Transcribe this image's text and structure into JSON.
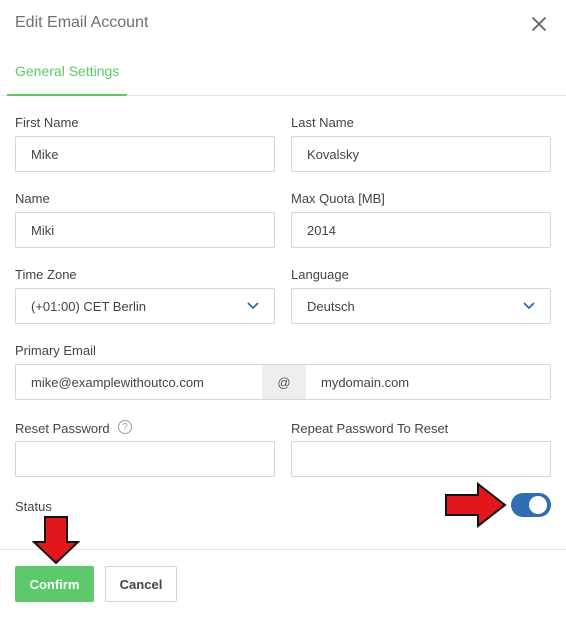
{
  "modal": {
    "title": "Edit Email Account",
    "close_icon": "close-icon"
  },
  "tabs": [
    {
      "label": "General Settings",
      "active": true
    }
  ],
  "form": {
    "first_name": {
      "label": "First Name",
      "value": "Mike"
    },
    "last_name": {
      "label": "Last Name",
      "value": "Kovalsky"
    },
    "name": {
      "label": "Name",
      "value": "Miki"
    },
    "max_quota": {
      "label": "Max Quota [MB]",
      "value": "2014"
    },
    "time_zone": {
      "label": "Time Zone",
      "value": "(+01:00) CET Berlin"
    },
    "language": {
      "label": "Language",
      "value": "Deutsch"
    },
    "primary_email": {
      "label": "Primary Email",
      "local": "mike@examplewithoutco.com",
      "at": "@",
      "domain": "mydomain.com"
    },
    "reset_password": {
      "label": "Reset Password",
      "help_icon": "question-circle-icon",
      "help_symbol": "?",
      "value": ""
    },
    "repeat_password": {
      "label": "Repeat Password To Reset",
      "value": ""
    },
    "status": {
      "label": "Status",
      "enabled": true
    }
  },
  "footer": {
    "confirm_label": "Confirm",
    "cancel_label": "Cancel"
  },
  "colors": {
    "accent_green": "#5cc96a",
    "toggle_blue": "#2f6db5",
    "annotation_arrow": "#e3161c"
  }
}
